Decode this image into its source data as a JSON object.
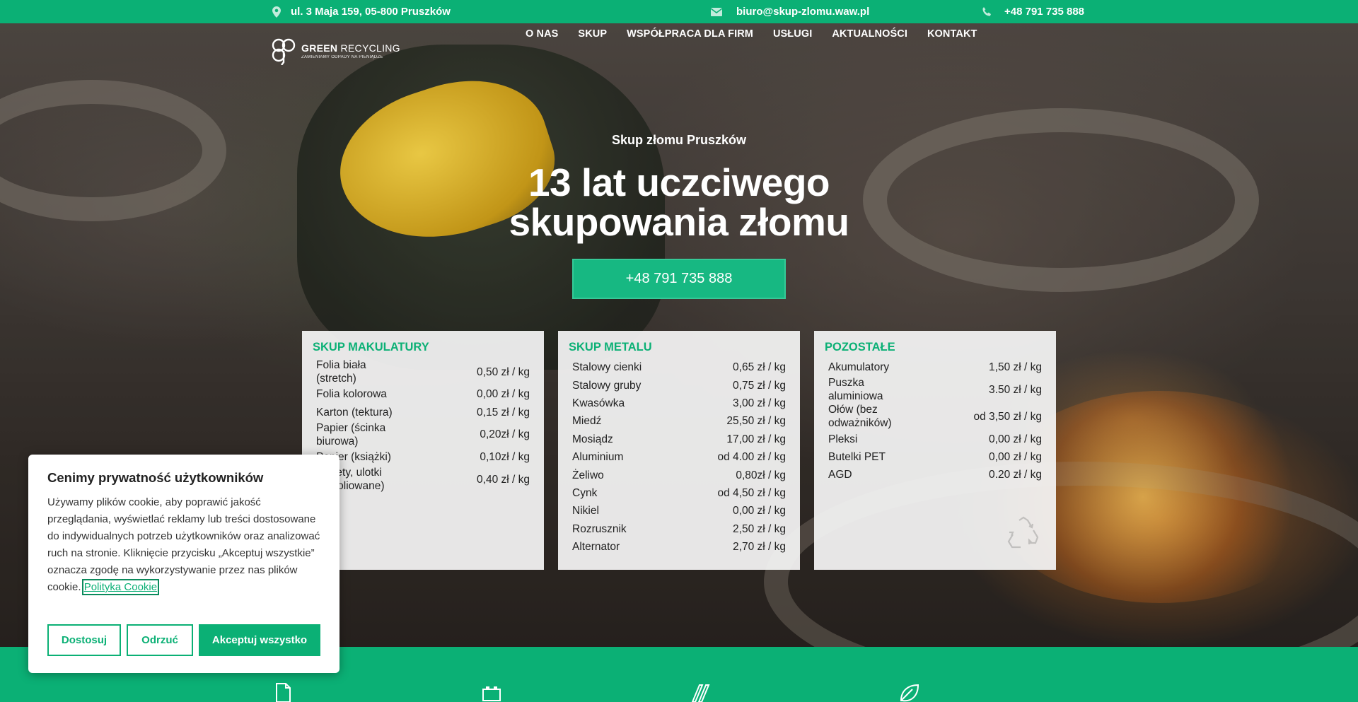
{
  "topbar": {
    "address": "ul. 3 Maja 159, 05-800 Pruszków",
    "email": "biuro@skup-zlomu.waw.pl",
    "phone": "+48 791 735 888"
  },
  "logo": {
    "name_bold": "GREEN",
    "name_light": " RECYCLING",
    "tagline": "ZAMIENIAMY ODPADY NA PIENIĄDZE"
  },
  "nav": [
    "O NAS",
    "SKUP",
    "WSPÓŁPRACA DLA FIRM",
    "USŁUGI",
    "AKTUALNOŚCI",
    "KONTAKT"
  ],
  "hero": {
    "subtitle": "Skup złomu Pruszków",
    "title_line1": "13 lat uczciwego",
    "title_line2": "skupowania złomu",
    "cta": "+48 791 735 888"
  },
  "cards": [
    {
      "title": "SKUP MAKULATURY",
      "rows": [
        {
          "name": "Folia biała (stretch)",
          "price": "0,50 zł / kg"
        },
        {
          "name": "Folia kolorowa",
          "price": "0,00 zł / kg"
        },
        {
          "name": "Karton (tektura)",
          "price": "0,15 zł / kg"
        },
        {
          "name": "Papier (ścinka biurowa)",
          "price": "0,20zł / kg"
        },
        {
          "name": "Papier (książki)",
          "price": "0,10zł / kg"
        },
        {
          "name": "Gazety, ulotki (niefoliowane)",
          "price": "0,40 zł / kg"
        }
      ]
    },
    {
      "title": "SKUP METALU",
      "rows": [
        {
          "name": "Stalowy cienki",
          "price": "0,65 zł / kg"
        },
        {
          "name": "Stalowy gruby",
          "price": "0,75 zł / kg"
        },
        {
          "name": "Kwasówka",
          "price": "3,00 zł / kg"
        },
        {
          "name": "Miedź",
          "price": "25,50 zł / kg"
        },
        {
          "name": "Mosiądz",
          "price": "17,00 zł / kg"
        },
        {
          "name": "Aluminium",
          "price": "od 4.00 zł / kg"
        },
        {
          "name": "Żeliwo",
          "price": "0,80zł / kg"
        },
        {
          "name": "Cynk",
          "price": "od 4,50 zł / kg"
        },
        {
          "name": "Nikiel",
          "price": "0,00 zł / kg"
        },
        {
          "name": "Rozrusznik",
          "price": "2,50 zł / kg"
        },
        {
          "name": "Alternator",
          "price": "2,70 zł / kg"
        }
      ]
    },
    {
      "title": "POZOSTAŁE",
      "rows": [
        {
          "name": "Akumulatory",
          "price": "1,50 zł / kg"
        },
        {
          "name": "Puszka aluminiowa",
          "price": "3.50 zł / kg"
        },
        {
          "name": "Ołów (bez odważników)",
          "price": "od 3,50 zł / kg"
        },
        {
          "name": "Pleksi",
          "price": "0,00 zł / kg"
        },
        {
          "name": "Butelki PET",
          "price": "0,00 zł / kg"
        },
        {
          "name": "AGD",
          "price": "0.20 zł / kg"
        }
      ]
    }
  ],
  "cookie": {
    "title": "Cenimy prywatność użytkowników",
    "text": "Używamy plików cookie, aby poprawić jakość przeglądania, wyświetlać reklamy lub treści dostosowane do indywidualnych potrzeb użytkowników oraz analizować ruch na stronie. Kliknięcie przycisku „Akceptuj wszystkie” oznacza zgodę na wykorzystywanie przez nas plików cookie. ",
    "policy_link": "Polityka Cookie",
    "btn_customize": "Dostosuj",
    "btn_reject": "Odrzuć",
    "btn_accept": "Akceptuj wszystko"
  },
  "icons": {
    "address": "map-pin-icon",
    "email": "envelope-icon",
    "phone": "phone-icon",
    "recycle": "recycle-icon",
    "band": [
      "document-recycle-icon",
      "battery-icon",
      "metal-bars-icon",
      "leaf-icon"
    ]
  },
  "colors": {
    "brand_green": "#0bb075",
    "card_bg": "#f5f5f5"
  }
}
